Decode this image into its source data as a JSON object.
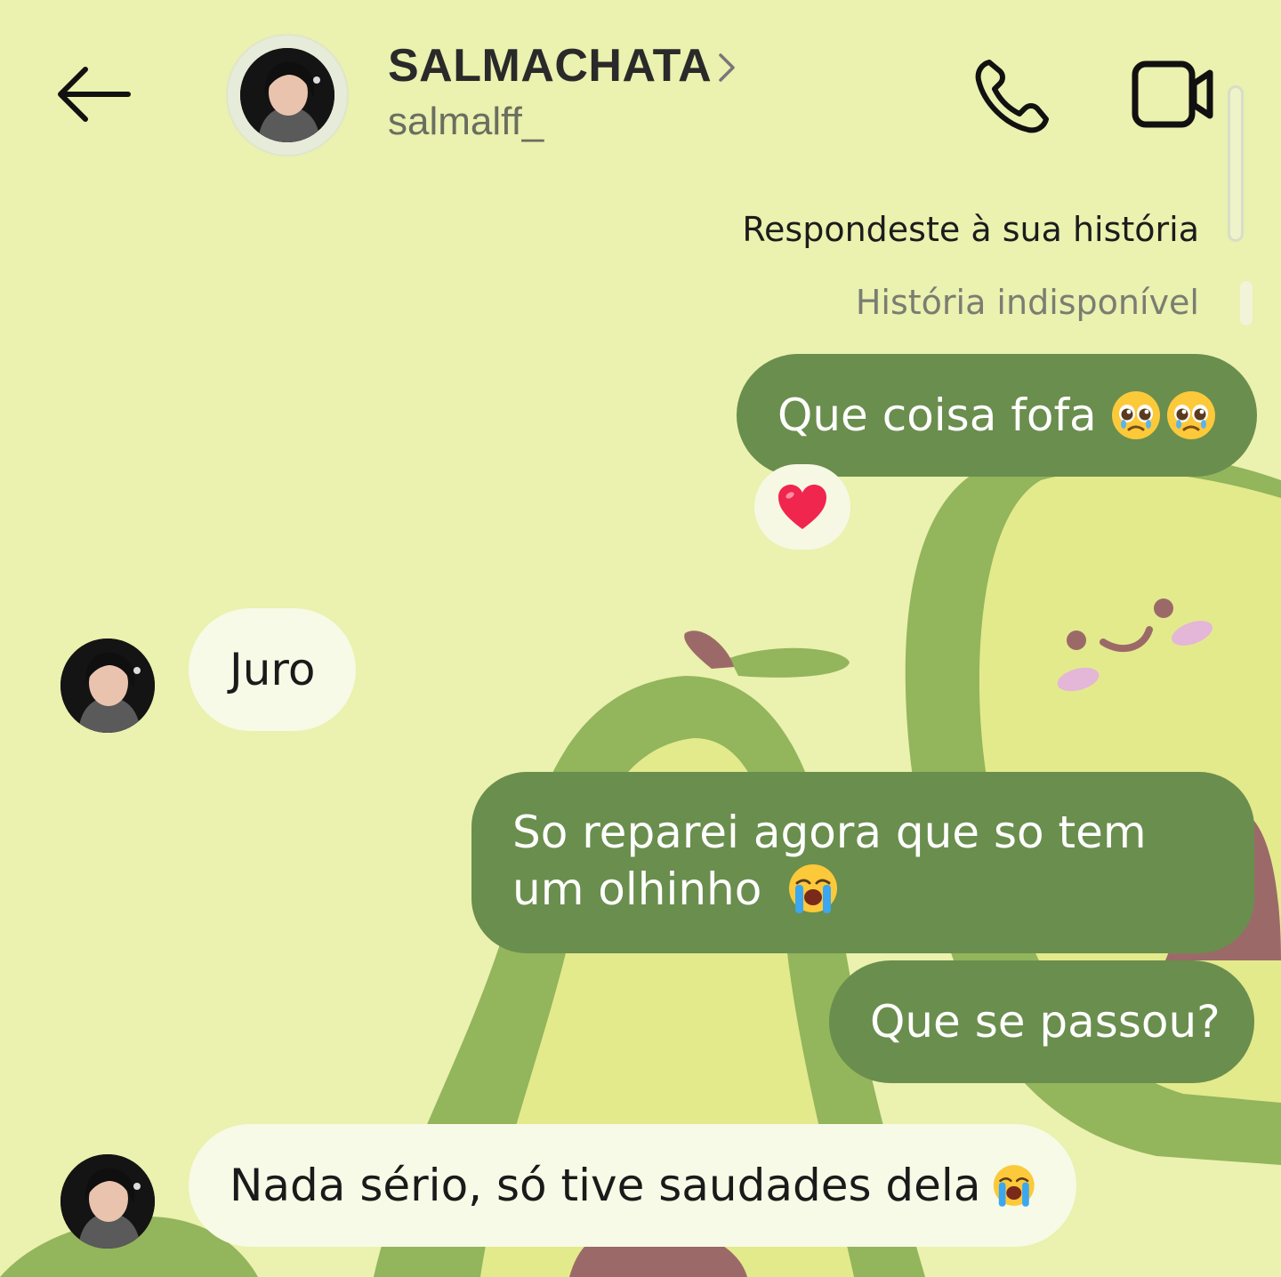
{
  "header": {
    "title": "SALMACHATA",
    "username": "salmalff_"
  },
  "story": {
    "reply_note": "Respondeste à sua história",
    "unavailable": "História indisponível"
  },
  "messages": [
    {
      "side": "out",
      "text": "Que coisa fofa",
      "emoji": [
        "pleading-face-emoji",
        "pleading-face-emoji"
      ],
      "reaction": "red-heart-emoji"
    },
    {
      "side": "in",
      "text": "Juro"
    },
    {
      "side": "out",
      "text": "So reparei agora que so tem um olhinho",
      "emoji": [
        "loudly-crying-face-emoji"
      ]
    },
    {
      "side": "out",
      "text": "Que se passou?"
    },
    {
      "side": "in",
      "text": "Nada sério, só tive saudades dela",
      "emoji": [
        "loudly-crying-face-emoji"
      ]
    }
  ],
  "icons": {
    "back": "arrow-left-icon",
    "call": "phone-icon",
    "video": "video-camera-icon",
    "chevron": "chevron-right-icon"
  },
  "colors": {
    "background": "#ebf1ae",
    "outgoing_bubble": "#6a8e4d",
    "incoming_bubble": "#f7fae6"
  }
}
